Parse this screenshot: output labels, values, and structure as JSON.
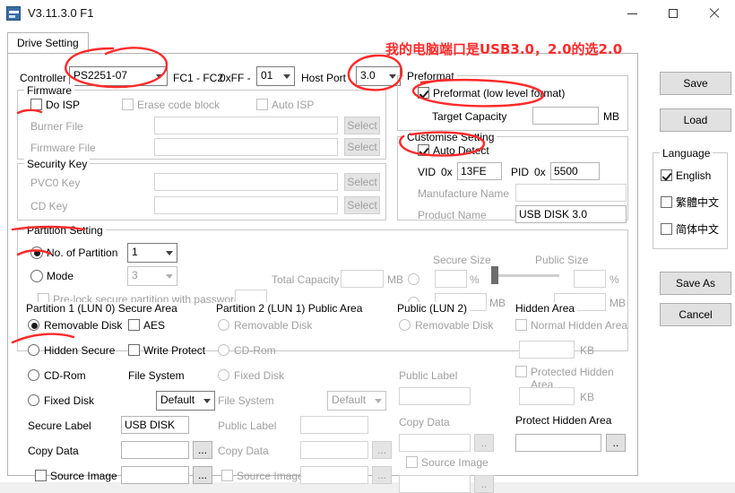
{
  "window": {
    "title": "V3.11.3.0 F1",
    "minimize": "–",
    "maximize": "□",
    "close": "✕"
  },
  "tab": {
    "label": "Drive Setting"
  },
  "controller": {
    "label": "Controller",
    "value": "PS2251-07",
    "fc_label": "FC1 - FC2",
    "hex_label": "0xFF -",
    "fc_value": "01",
    "host_port_label": "Host Port",
    "host_port_value": "3.0"
  },
  "firmware": {
    "legend": "Firmware",
    "do_isp": "Do ISP",
    "erase_code_block": "Erase code block",
    "auto_isp": "Auto ISP",
    "burner_file_label": "Burner File",
    "burner_file_value": "",
    "firmware_file_label": "Firmware File",
    "firmware_file_value": "",
    "select1": "Select",
    "select2": "Select"
  },
  "security_key": {
    "legend": "Security Key",
    "pvc0_label": "PVC0 Key",
    "pvc0_value": "",
    "cd_label": "CD Key",
    "cd_value": "",
    "select1": "Select",
    "select2": "Select"
  },
  "preformat": {
    "legend": "Preformat",
    "preformat_check": "Preformat (low level format)",
    "target_capacity_label": "Target Capacity",
    "target_capacity_value": "",
    "mb": "MB"
  },
  "customise": {
    "legend": "Customise Setting",
    "auto_detect": "Auto Detect",
    "vid_label": "VID",
    "vid_prefix": "0x",
    "vid_value": "13FE",
    "pid_label": "PID",
    "pid_prefix": "0x",
    "pid_value": "5500",
    "manufacture_label": "Manufacture Name",
    "manufacture_value": "",
    "product_label": "Product Name",
    "product_value": "USB DISK 3.0"
  },
  "partition": {
    "legend": "Partition Setting",
    "no_of_partition": "No. of Partition",
    "no_of_partition_value": "1",
    "mode": "Mode",
    "mode_value": "3",
    "prelock": "Pre-lock secure partition with password :",
    "prelock_value": "",
    "total_capacity_label": "Total Capacity",
    "total_capacity_value": "",
    "total_capacity_unit": "MB",
    "secure_size_label": "Secure Size",
    "public_size_label": "Public Size",
    "secure_percent_value": "",
    "secure_percent_unit": "%",
    "public_percent_value": "",
    "public_percent_unit": "%",
    "secure_mb_value": "",
    "secure_mb_unit": "MB",
    "public_mb_value": "",
    "public_mb_unit": "MB"
  },
  "part1": {
    "legend": "Partition 1 (LUN 0) Secure Area",
    "removable_disk": "Removable Disk",
    "hidden_secure": "Hidden Secure",
    "cd_rom": "CD-Rom",
    "fixed_disk": "Fixed Disk",
    "aes": "AES",
    "write_protect": "Write Protect",
    "file_system_label": "File System",
    "file_system_value": "Default",
    "secure_label_label": "Secure Label",
    "secure_label_value": "USB DISK",
    "copy_data_label": "Copy Data",
    "copy_data_value": "",
    "source_image_label": "Source Image",
    "source_image_value": "",
    "dots": "..."
  },
  "part2": {
    "legend": "Partition 2 (LUN 1) Public Area",
    "removable_disk": "Removable Disk",
    "cd_rom": "CD-Rom",
    "fixed_disk": "Fixed Disk",
    "file_system_label": "File System",
    "file_system_value": "Default",
    "public_label_label": "Public Label",
    "public_label_value": "",
    "copy_data_label": "Copy Data",
    "copy_data_value": "",
    "source_image_label": "Source Image",
    "source_image_value": "",
    "dots": "..."
  },
  "public_lun2": {
    "legend": "Public (LUN 2)",
    "removable_disk": "Removable Disk",
    "public_label_label": "Public Label",
    "public_label_value": "",
    "copy_data_label": "Copy Data",
    "copy_data_value": "",
    "source_image_label": "Source Image",
    "source_image_value": "",
    "dots1": "..",
    "dots2": ".."
  },
  "hidden_area": {
    "legend": "Hidden Area",
    "normal_hidden": "Normal Hidden Area",
    "normal_value": "",
    "normal_unit": "KB",
    "protected_hidden": "Protected Hidden Area",
    "protected_value": "",
    "protected_unit": "KB",
    "protect_hidden_label": "Protect Hidden Area",
    "protect_hidden_value": "",
    "dots": ".."
  },
  "sidebar": {
    "save": "Save",
    "load": "Load",
    "language_legend": "Language",
    "lang_english": "English",
    "lang_trad": "繁體中文",
    "lang_simp": "简体中文",
    "save_as": "Save As",
    "cancel": "Cancel"
  },
  "annotation": {
    "note": "我的电脑端口是USB3.0，2.0的选2.0",
    "color": "#ff2a2a"
  }
}
